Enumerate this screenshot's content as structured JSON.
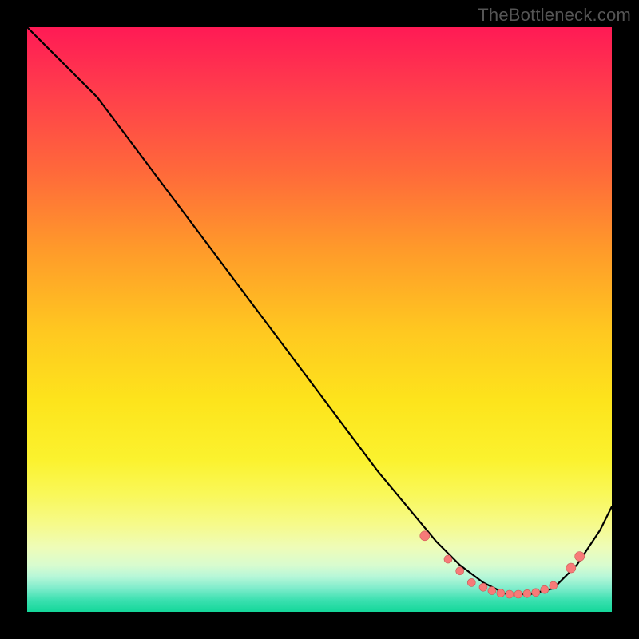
{
  "watermark": "TheBottleneck.com",
  "colors": {
    "background": "#000000",
    "curve": "#000000",
    "dot_fill": "#f77a78",
    "dot_stroke": "#c95a56"
  },
  "chart_data": {
    "type": "line",
    "title": "",
    "xlabel": "",
    "ylabel": "",
    "xlim": [
      0,
      100
    ],
    "ylim": [
      0,
      100
    ],
    "series": [
      {
        "name": "bottleneck-curve",
        "x": [
          0,
          4,
          8,
          12,
          18,
          24,
          30,
          36,
          42,
          48,
          54,
          60,
          65,
          70,
          74,
          78,
          82,
          86,
          90,
          94,
          98,
          100
        ],
        "y": [
          100,
          96,
          92,
          88,
          80,
          72,
          64,
          56,
          48,
          40,
          32,
          24,
          18,
          12,
          8,
          5,
          3,
          3,
          4,
          8,
          14,
          18
        ]
      }
    ],
    "markers": {
      "name": "trough-dots",
      "x": [
        68,
        72,
        74,
        76,
        78,
        79.5,
        81,
        82.5,
        84,
        85.5,
        87,
        88.5,
        90,
        93,
        94.5
      ],
      "y": [
        13,
        9,
        7,
        5,
        4.2,
        3.6,
        3.2,
        3.0,
        3.0,
        3.1,
        3.3,
        3.8,
        4.5,
        7.5,
        9.5
      ],
      "r": [
        6,
        5,
        5,
        5,
        5,
        5,
        5,
        5,
        5,
        5,
        5,
        5,
        5,
        6,
        6
      ]
    }
  }
}
